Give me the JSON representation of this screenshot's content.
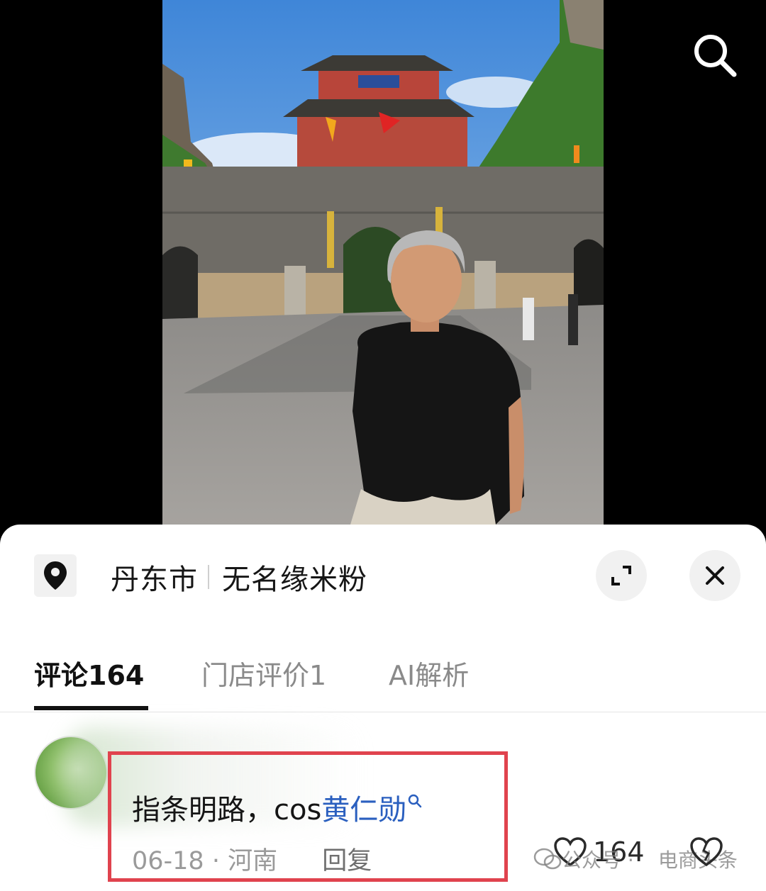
{
  "header": {
    "search_icon": "search-icon"
  },
  "sheet": {
    "location_icon": "map-pin-icon",
    "city": "丹东市",
    "shop_name": "无名缘米粉",
    "expand_icon": "expand-icon",
    "close_icon": "close-icon"
  },
  "tabs": [
    {
      "label": "评论164",
      "active": true
    },
    {
      "label": "门店评价1",
      "active": false
    },
    {
      "label": "AI解析",
      "active": false
    }
  ],
  "comment": {
    "text_prefix": "指条明路，cos",
    "mention": "黄仁勋",
    "date": "06-18",
    "separator": "·",
    "region": "河南",
    "reply_label": "回复",
    "like_count": "164"
  },
  "watermark": {
    "account_label": "公众号 ·",
    "source": "电商头条"
  },
  "colors": {
    "highlight_border": "#e0434e",
    "mention": "#2a5fbf",
    "sheet_bg": "#ffffff",
    "video_bg": "#000000"
  }
}
